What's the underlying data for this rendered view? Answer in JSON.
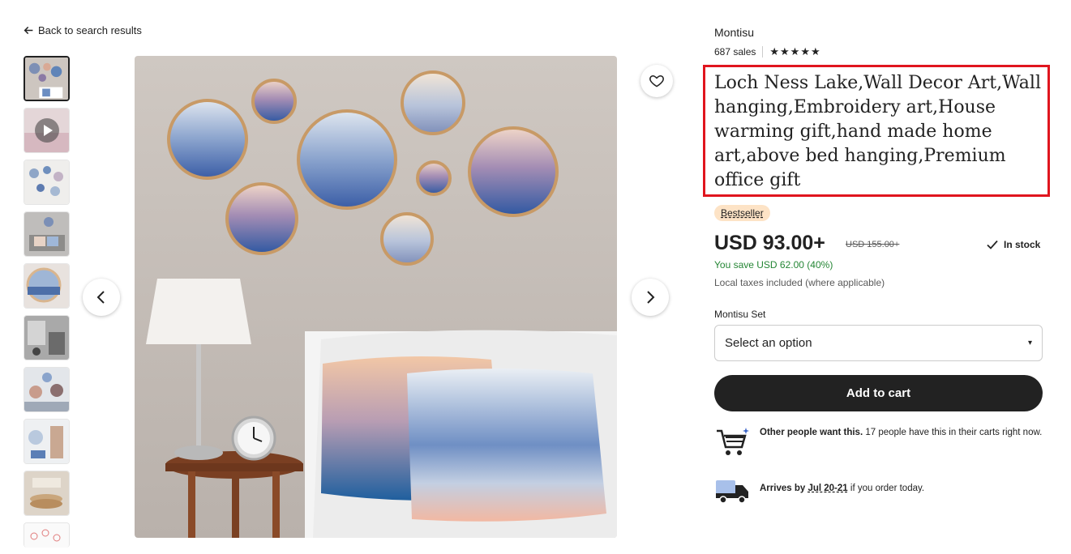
{
  "back_link": "Back to search results",
  "shop": {
    "name": "Montisu",
    "sales": "687 sales",
    "stars": "★★★★★"
  },
  "product": {
    "title": "Loch Ness Lake,Wall Decor Art,Wall hanging,Embroidery art,House warming gift,hand made home art,above bed hanging,Premium office gift",
    "badge": "Bestseller",
    "price": "USD 93.00+",
    "original_price": "USD 155.00+",
    "stock": "In stock",
    "savings": "You save USD 62.00 (40%)",
    "tax_note": "Local taxes included (where applicable)"
  },
  "variant": {
    "label": "Montisu Set",
    "placeholder": "Select an option",
    "caret": "▾"
  },
  "cart_button": "Add to cart",
  "notices": {
    "demand_bold": "Other people want this.",
    "demand_rest": " 17 people have this in their carts right now.",
    "arrives_prefix": "Arrives by ",
    "arrives_date": "Jul 20-21",
    "arrives_suffix": " if you order today."
  },
  "colors": {
    "title_highlight": "#e0151e",
    "badge_bg": "#fde3c6",
    "savings_green": "#258635",
    "cart_button_bg": "#222222"
  },
  "icons": [
    "arrow-left-icon",
    "play-icon",
    "chevron-left-icon",
    "chevron-right-icon",
    "heart-icon",
    "checkmark-icon",
    "cart-icon",
    "truck-icon"
  ]
}
